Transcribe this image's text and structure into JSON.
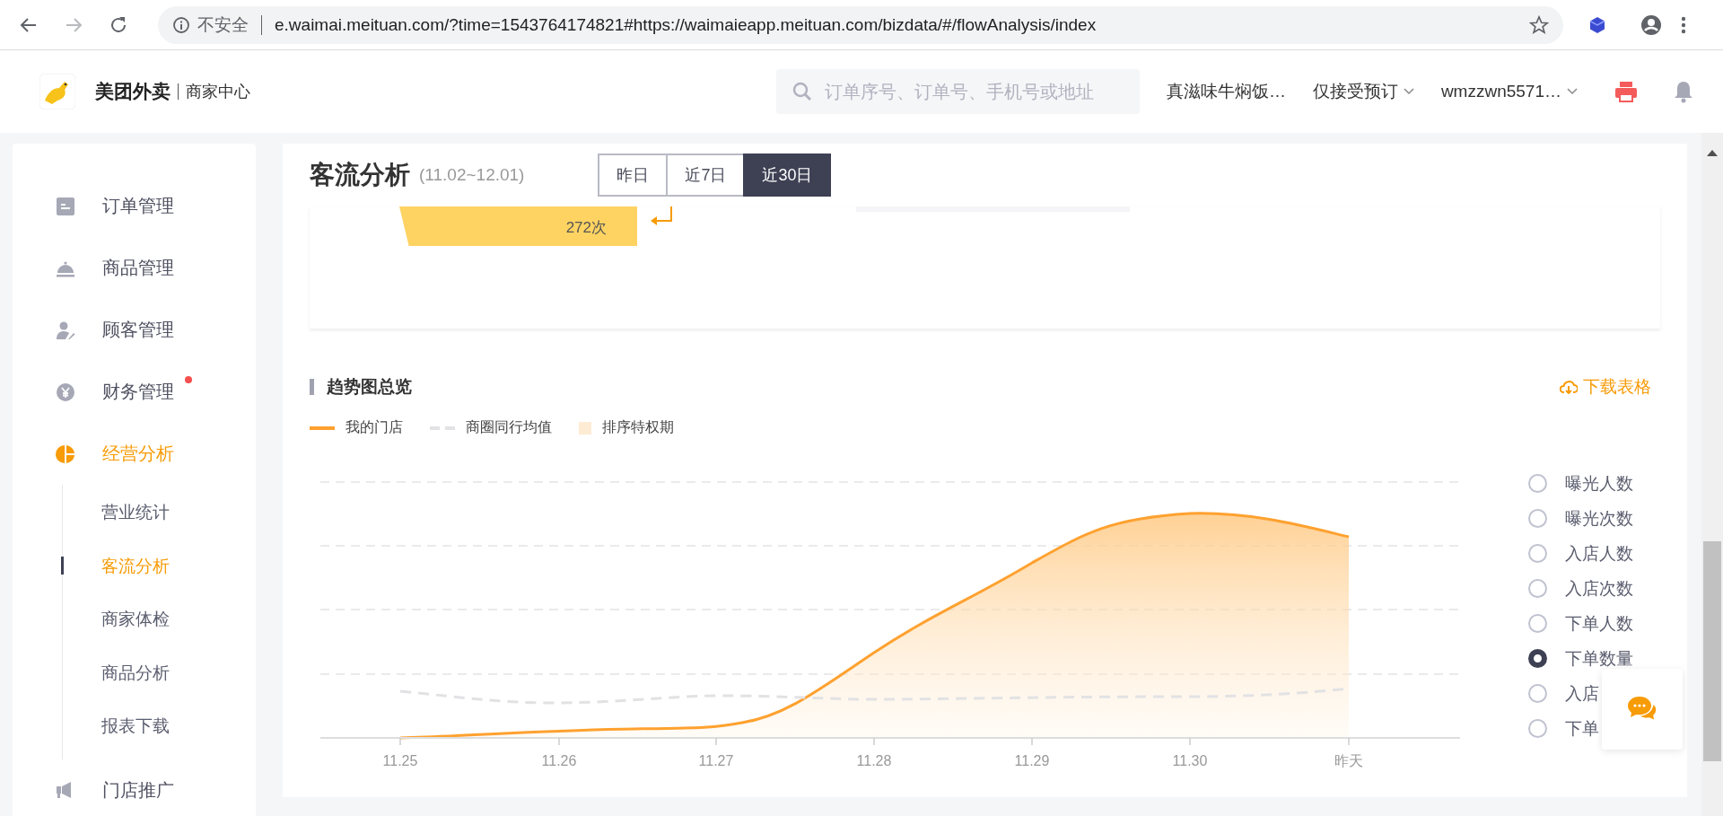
{
  "browser": {
    "security": "不安全",
    "url": "e.waimai.meituan.com/?time=1543764174821#https://waimaieapp.meituan.com/bizdata/#/flowAnalysis/index"
  },
  "header": {
    "brand": "美团外卖",
    "subtitle": "商家中心",
    "search": {
      "placeholder": "订单序号、订单号、手机号或地址"
    },
    "store": "真滋味牛焖饭…",
    "order_mode": "仅接受预订",
    "account": "wmzzwn5571…"
  },
  "sidebar": {
    "items": [
      {
        "label": "订单管理",
        "kind": "orders",
        "selected": false,
        "notified": false
      },
      {
        "label": "商品管理",
        "kind": "goods",
        "selected": false,
        "notified": false
      },
      {
        "label": "顾客管理",
        "kind": "customers",
        "selected": false,
        "notified": false
      },
      {
        "label": "财务管理",
        "kind": "finance",
        "selected": false,
        "notified": true
      },
      {
        "label": "经营分析",
        "kind": "analysis",
        "selected": true,
        "notified": false,
        "children": [
          {
            "label": "营业统计",
            "selected": false
          },
          {
            "label": "客流分析",
            "selected": true
          },
          {
            "label": "商家体检",
            "selected": false
          },
          {
            "label": "商品分析",
            "selected": false
          },
          {
            "label": "报表下载",
            "selected": false
          }
        ]
      },
      {
        "label": "门店推广",
        "kind": "promotion",
        "selected": false,
        "notified": false
      }
    ]
  },
  "page": {
    "title": "客流分析",
    "range": "(11.02~12.01)",
    "periods": [
      {
        "label": "昨日",
        "selected": false
      },
      {
        "label": "近7日",
        "selected": false
      },
      {
        "label": "近30日",
        "selected": true
      }
    ],
    "funnel": {
      "value": "272次"
    },
    "trend": {
      "title": "趋势图总览",
      "download": "下载表格",
      "legend": [
        {
          "label": "我的门店",
          "kind": "line"
        },
        {
          "label": "商圈同行均值",
          "kind": "dashed"
        },
        {
          "label": "排序特权期",
          "kind": "block"
        }
      ],
      "x_labels": [
        "11.25",
        "11.26",
        "11.27",
        "11.28",
        "11.29",
        "11.30",
        "昨天"
      ],
      "metrics": [
        {
          "label": "曝光人数",
          "selected": false
        },
        {
          "label": "曝光次数",
          "selected": false
        },
        {
          "label": "入店人数",
          "selected": false
        },
        {
          "label": "入店次数",
          "selected": false
        },
        {
          "label": "下单人数",
          "selected": false
        },
        {
          "label": "下单数量",
          "selected": true
        },
        {
          "label": "入店",
          "selected": false
        },
        {
          "label": "下单",
          "selected": false
        }
      ]
    }
  }
}
